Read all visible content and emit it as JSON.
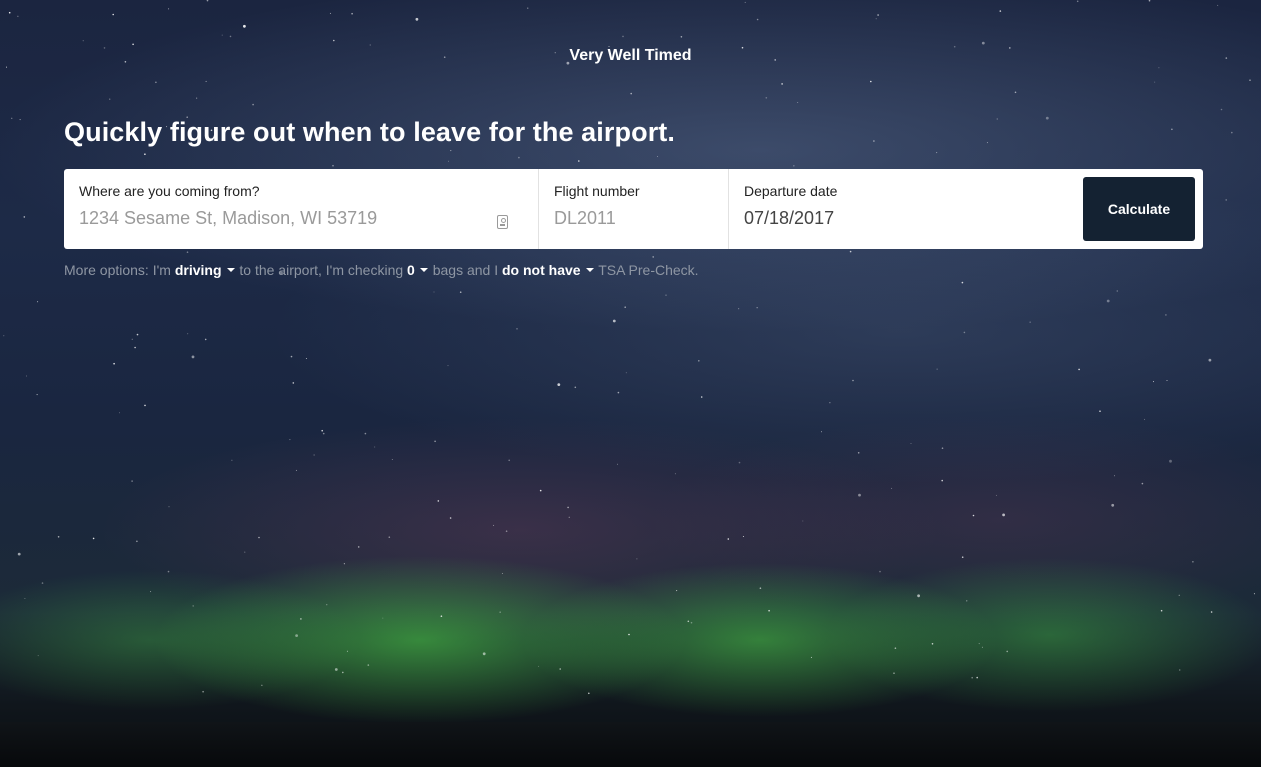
{
  "header": {
    "site_title": "Very Well Timed",
    "headline": "Quickly figure out when to leave for the airport."
  },
  "form": {
    "origin": {
      "label": "Where are you coming from?",
      "placeholder": "1234 Sesame St, Madison, WI 53719",
      "value": ""
    },
    "flight": {
      "label": "Flight number",
      "placeholder": "DL2011",
      "value": ""
    },
    "date": {
      "label": "Departure date",
      "placeholder": "",
      "value": "07/18/2017"
    },
    "calculate_label": "Calculate"
  },
  "more_options": {
    "prefix": "More options: I'm",
    "transport": "driving",
    "text_2": "to the airport, I'm checking",
    "bags": "0",
    "text_3": "bags and I",
    "precheck": "do not have",
    "suffix": "TSA Pre-Check."
  },
  "icons": {
    "origin_field_icon": "contact-card-icon",
    "dropdown_icon": "caret-down-icon"
  },
  "colors": {
    "button_bg": "#142232",
    "muted_text": "#8e96a3"
  }
}
